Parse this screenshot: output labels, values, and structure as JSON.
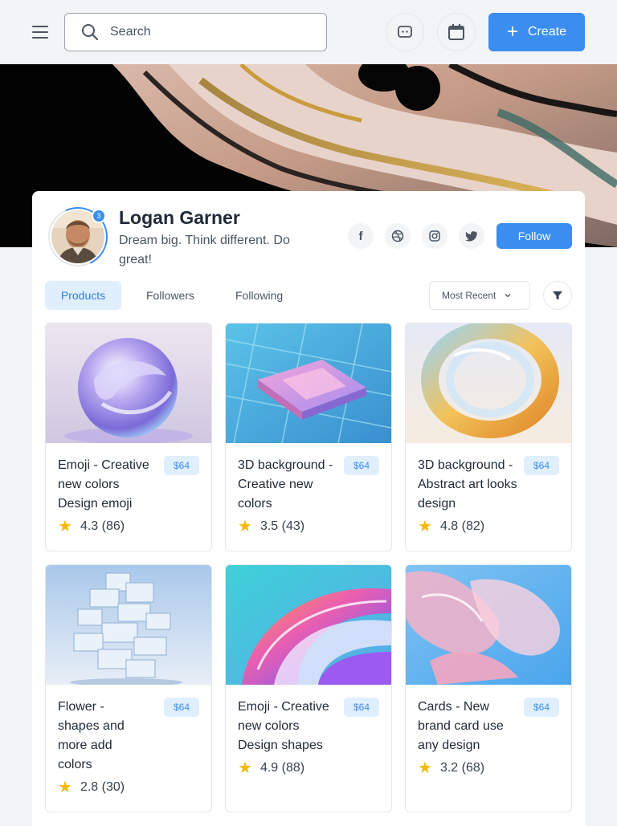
{
  "header": {
    "search_placeholder": "Search",
    "create_label": "Create"
  },
  "profile": {
    "name": "Logan Garner",
    "bio": "Dream big. Think different. Do great!",
    "notification_count": "3",
    "follow_label": "Follow"
  },
  "tabs": [
    "Products",
    "Followers",
    "Following"
  ],
  "sort": {
    "selected": "Most Recent"
  },
  "colors": {
    "accent": "#3b8ef0",
    "price_bg": "#e0effe",
    "star": "#f5b80b"
  },
  "products": [
    {
      "title": "Emoji - Creative new colors Design emoji",
      "price": "$64",
      "rating": "4.3 (86)",
      "image": "glass-sphere"
    },
    {
      "title": "3D background - Creative new colors",
      "price": "$64",
      "rating": "3.5 (43)",
      "image": "circuit-board"
    },
    {
      "title": "3D background - Abstract art looks design",
      "price": "$64",
      "rating": "4.8 (82)",
      "image": "glass-ring"
    },
    {
      "title": "Flower - shapes and more add colors",
      "price": "$64",
      "rating": "2.8 (30)",
      "image": "glass-cubes"
    },
    {
      "title": "Emoji - Creative new colors Design shapes",
      "price": "$64",
      "rating": "4.9 (88)",
      "image": "iridescent-wave"
    },
    {
      "title": "Cards - New brand card use any design",
      "price": "$64",
      "rating": "3.2 (68)",
      "image": "pink-glass"
    }
  ]
}
